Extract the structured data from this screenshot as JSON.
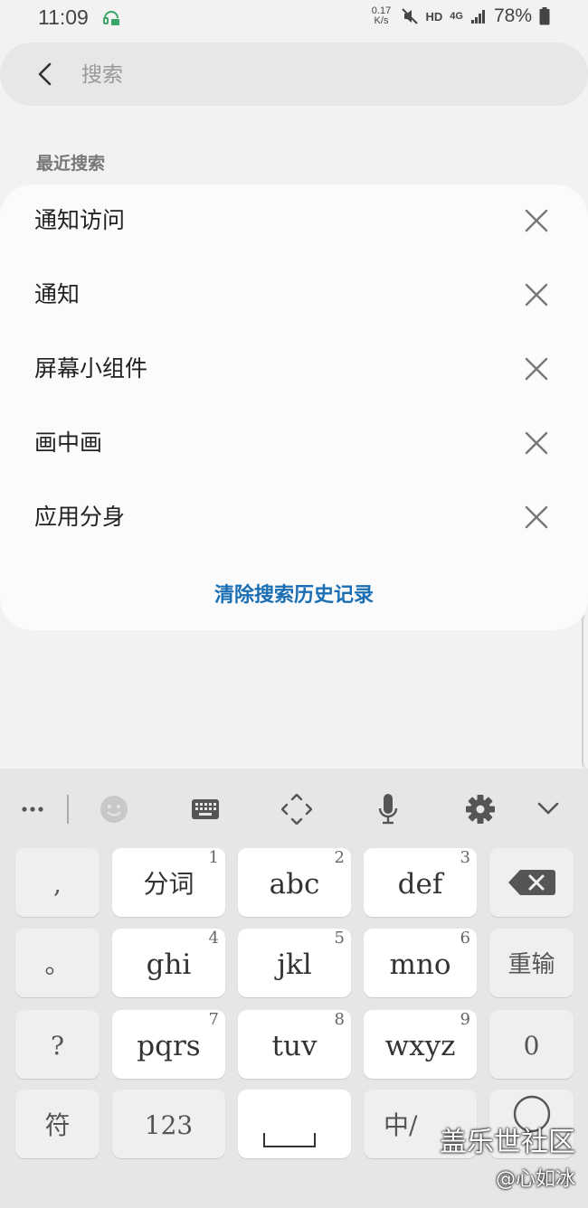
{
  "status_bar": {
    "time": "11:09",
    "net_speed_value": "0.17",
    "net_speed_unit": "K/s",
    "hd": "HD",
    "network": "4G",
    "battery": "78%"
  },
  "search": {
    "placeholder": "搜索"
  },
  "recent": {
    "title": "最近搜索",
    "items": [
      {
        "label": "通知访问"
      },
      {
        "label": "通知"
      },
      {
        "label": "屏幕小组件"
      },
      {
        "label": "画中画"
      },
      {
        "label": "应用分身"
      }
    ],
    "clear_label": "清除搜索历史记录"
  },
  "keyboard": {
    "toolbar": [
      "more-icon",
      "emoji-icon",
      "keyboard-icon",
      "move-icon",
      "mic-icon",
      "settings-icon",
      "hide-keyboard-icon"
    ],
    "keys": {
      "comma": ",",
      "fenci": "分词",
      "fenci_num": "1",
      "abc": "abc",
      "abc_num": "2",
      "def": "def",
      "def_num": "3",
      "period": "。",
      "ghi": "ghi",
      "ghi_num": "4",
      "jkl": "jkl",
      "jkl_num": "5",
      "mno": "mno",
      "mno_num": "6",
      "reinput": "重输",
      "question": "?",
      "pqrs": "pqrs",
      "pqrs_num": "7",
      "tuv": "tuv",
      "tuv_num": "8",
      "wxyz": "wxyz",
      "wxyz_num": "9",
      "zero": "0",
      "symbol": "符",
      "num123": "123",
      "lang": "中/"
    }
  },
  "watermark": {
    "line1": "盖乐世社区",
    "line2": "@心如冰"
  },
  "colors": {
    "background": "#f2f2f2",
    "card": "#fbfbfb",
    "link": "#1a6fb4",
    "keyboard": "#e6e6e6"
  }
}
